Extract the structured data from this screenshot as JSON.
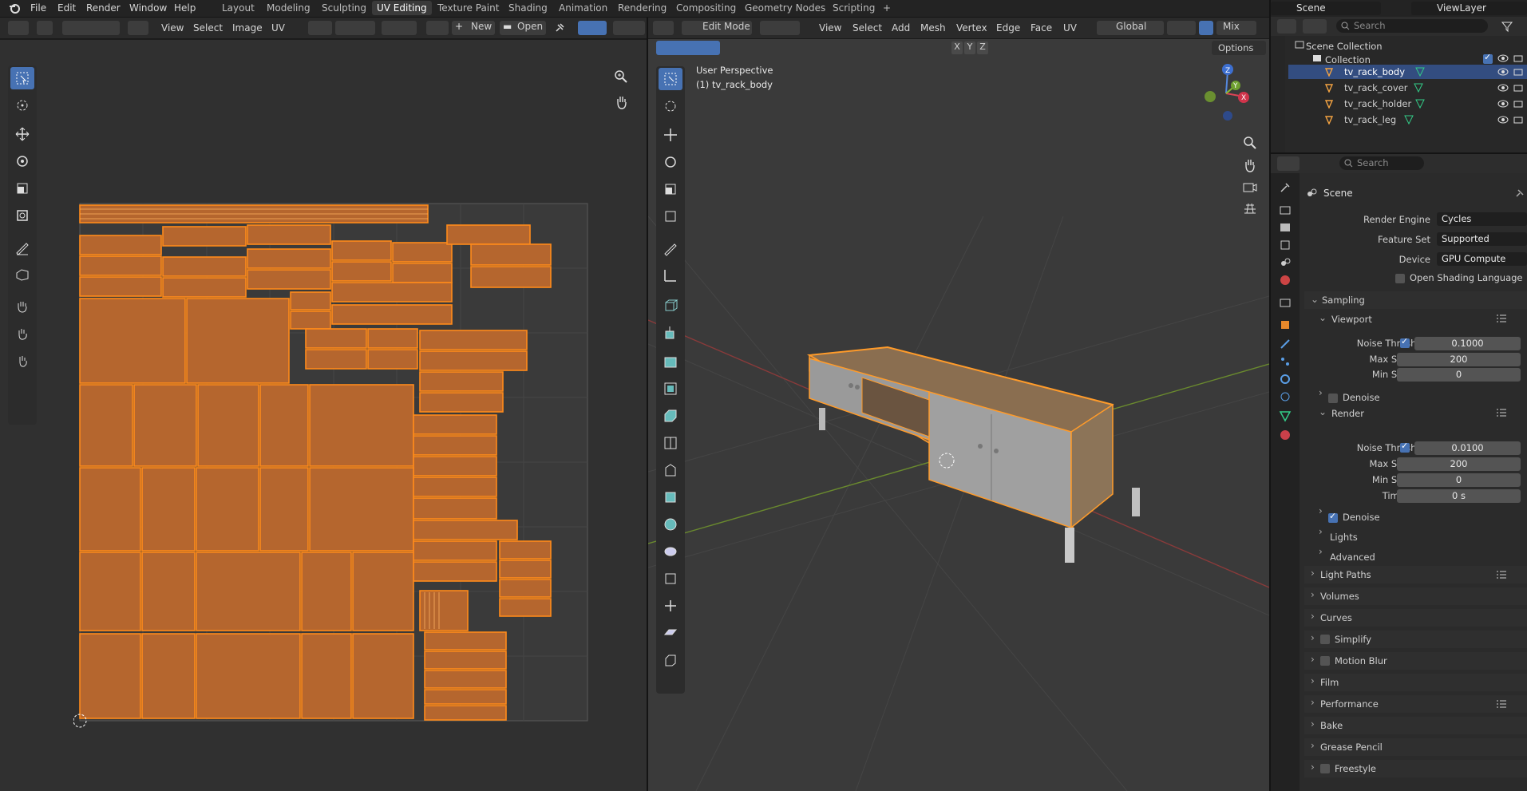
{
  "menu": {
    "file": "File",
    "edit": "Edit",
    "render": "Render",
    "window": "Window",
    "help": "Help"
  },
  "workspaces": [
    "Layout",
    "Modeling",
    "Sculpting",
    "UV Editing",
    "Texture Paint",
    "Shading",
    "Animation",
    "Rendering",
    "Compositing",
    "Geometry Nodes",
    "Scripting",
    "+"
  ],
  "topright": {
    "scene": "Scene",
    "viewlayer": "ViewLayer"
  },
  "uv_header": {
    "view": "View",
    "select": "Select",
    "image": "Image",
    "uv": "UV",
    "new": "New",
    "open": "Open"
  },
  "vp_header": {
    "mode": "Edit Mode",
    "view": "View",
    "select": "Select",
    "add": "Add",
    "mesh": "Mesh",
    "vertex": "Vertex",
    "edge": "Edge",
    "face": "Face",
    "uv": "UV",
    "orientation": "Global",
    "shading": "Mix"
  },
  "vp_sub": {
    "x": "X",
    "y": "Y",
    "z": "Z",
    "options": "Options"
  },
  "viewport": {
    "perspective": "User Perspective",
    "object": "(1) tv_rack_body"
  },
  "gizmo": {
    "z": "Z",
    "y": "Y",
    "x": "X"
  },
  "outliner": {
    "search_placeholder": "Search",
    "scene_collection": "Scene Collection",
    "collection": "Collection",
    "objects": [
      "tv_rack_body",
      "tv_rack_cover",
      "tv_rack_holder",
      "tv_rack_leg"
    ]
  },
  "properties": {
    "search_placeholder": "Search",
    "context": "Scene",
    "render_engine_label": "Render Engine",
    "render_engine": "Cycles",
    "feature_set_label": "Feature Set",
    "feature_set": "Supported",
    "device_label": "Device",
    "device": "GPU Compute",
    "osl": "Open Shading Language",
    "sampling": "Sampling",
    "viewport": "Viewport",
    "noise_threshold_label": "Noise Threshold",
    "vp_noise": "0.1000",
    "max_samples_label": "Max Samples",
    "vp_max": "200",
    "min_samples_label": "Min Samples",
    "vp_min": "0",
    "denoise": "Denoise",
    "render": "Render",
    "r_noise": "0.0100",
    "r_max": "200",
    "r_min": "0",
    "time_limit_label": "Time Limit",
    "time_limit": "0 s",
    "lights": "Lights",
    "advanced": "Advanced",
    "light_paths": "Light Paths",
    "volumes": "Volumes",
    "curves": "Curves",
    "simplify": "Simplify",
    "motion_blur": "Motion Blur",
    "film": "Film",
    "performance": "Performance",
    "bake": "Bake",
    "grease_pencil": "Grease Pencil",
    "freestyle": "Freestyle"
  },
  "colors": {
    "accent": "#4772b3",
    "uv_orange": "#c8702e",
    "uv_edge": "#ff8a1a",
    "selection": "#ff9b2a"
  }
}
